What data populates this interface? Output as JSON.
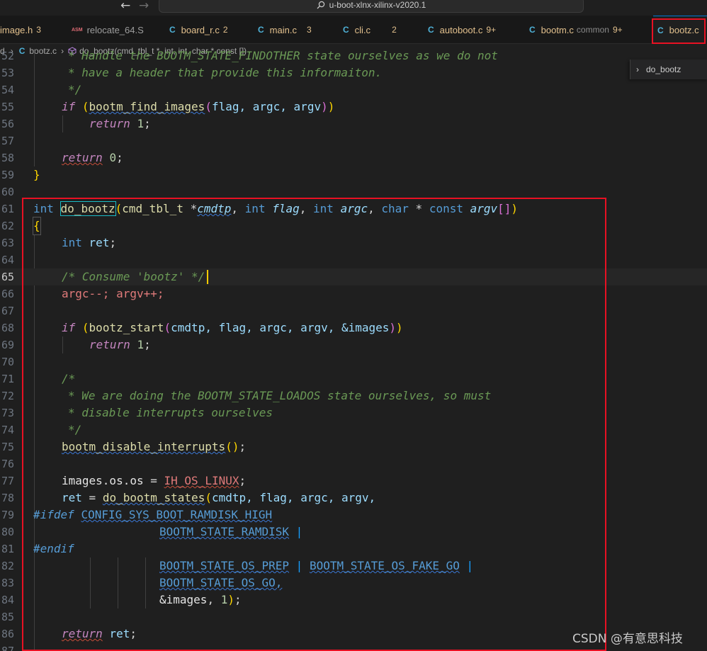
{
  "titlebar": {
    "back_icon": "←",
    "forward_icon": "→",
    "search_text": "u-boot-xlnx-xilinx-v2020.1"
  },
  "tabs": [
    {
      "label": "image.h",
      "count": "3",
      "icon": ""
    },
    {
      "label": "relocate_64.S",
      "count": "",
      "icon": "ASM"
    },
    {
      "label": "board_r.c",
      "count": "2",
      "icon": "C"
    },
    {
      "label": "main.c",
      "count": "3",
      "icon": "C"
    },
    {
      "label": "cli.c",
      "count": "2",
      "icon": "C"
    },
    {
      "label": "autoboot.c",
      "count": "9+",
      "icon": "C"
    },
    {
      "label": "bootm.c",
      "extra": "common",
      "count": "9+",
      "icon": "C"
    },
    {
      "label": "bootz.c",
      "count": "",
      "icon": "C"
    }
  ],
  "breadcrumb": {
    "prefix": "d",
    "file": "bootz.c",
    "symbol": "do_bootz(cmd_tbl_t *, int, int, char * const [])"
  },
  "outline": {
    "label": "do_bootz"
  },
  "line_numbers": [
    "53",
    "54",
    "55",
    "56",
    "57",
    "58",
    "59",
    "60",
    "61",
    "62",
    "63",
    "64",
    "65",
    "66",
    "67",
    "68",
    "69",
    "70",
    "71",
    "72",
    "73",
    "74",
    "75",
    "76",
    "77",
    "78",
    "79",
    "80",
    "81",
    "82",
    "83",
    "84",
    "85",
    "86",
    "87"
  ],
  "code": {
    "l52": "* Handle the BOOTM_STATE_FINDOTHER state ourselves as we do not",
    "l53": "* have a header that provide this informaiton.",
    "l54": "*/",
    "l55_kw": "if",
    "l55_fn": "bootm_find_images",
    "l55_args": "flag, argc, argv",
    "l56_kw": "return",
    "l56_num": "1",
    "l58_kw": "return",
    "l58_num": "0",
    "l59": "}",
    "l61_type": "int",
    "l61_fn": "do_bootz",
    "l61_t": "cmd_tbl_t",
    "l61_p1": "cmdtp",
    "l61_int": "int",
    "l61_p2": "flag",
    "l61_p3": "argc",
    "l61_char": "char",
    "l61_const": "const",
    "l61_p4": "argv",
    "l62": "{",
    "l63_type": "int",
    "l63_var": "ret",
    "l65": "/* Consume 'bootz' */",
    "l66": "argc--; argv++;",
    "l68_kw": "if",
    "l68_fn": "bootz_start",
    "l68_args": "cmdtp, flag, argc, argv, &images",
    "l69_kw": "return",
    "l69_num": "1",
    "l71": "/*",
    "l72": "* We are doing the BOOTM_STATE_LOADOS state ourselves, so must",
    "l73": "* disable interrupts ourselves",
    "l74": "*/",
    "l75_fn": "bootm_disable_interrupts",
    "l77_var": "images.os.os",
    "l77_mac": "IH_OS_LINUX",
    "l78_var": "ret",
    "l78_fn": "do_bootm_states",
    "l78_args": "cmdtp, flag, argc, argv,",
    "l79_dir": "#ifdef",
    "l79_mac": "CONFIG_SYS_BOOT_RAMDISK_HIGH",
    "l80_mac": "BOOTM_STATE_RAMDISK",
    "l81_dir": "#endif",
    "l82_mac1": "BOOTM_STATE_OS_PREP",
    "l82_mac2": "BOOTM_STATE_OS_FAKE_GO",
    "l83_mac": "BOOTM_STATE_OS_GO,",
    "l84_var": "&images",
    "l84_num": "1",
    "l86_kw": "return",
    "l86_var": "ret"
  },
  "watermark": "CSDN @有意思科技",
  "colors": {
    "accent_red": "#e81123",
    "keyword": "#569cd6",
    "control": "#c586c0",
    "function": "#dcdcaa",
    "variable": "#9cdcfe",
    "comment": "#6a9955"
  }
}
